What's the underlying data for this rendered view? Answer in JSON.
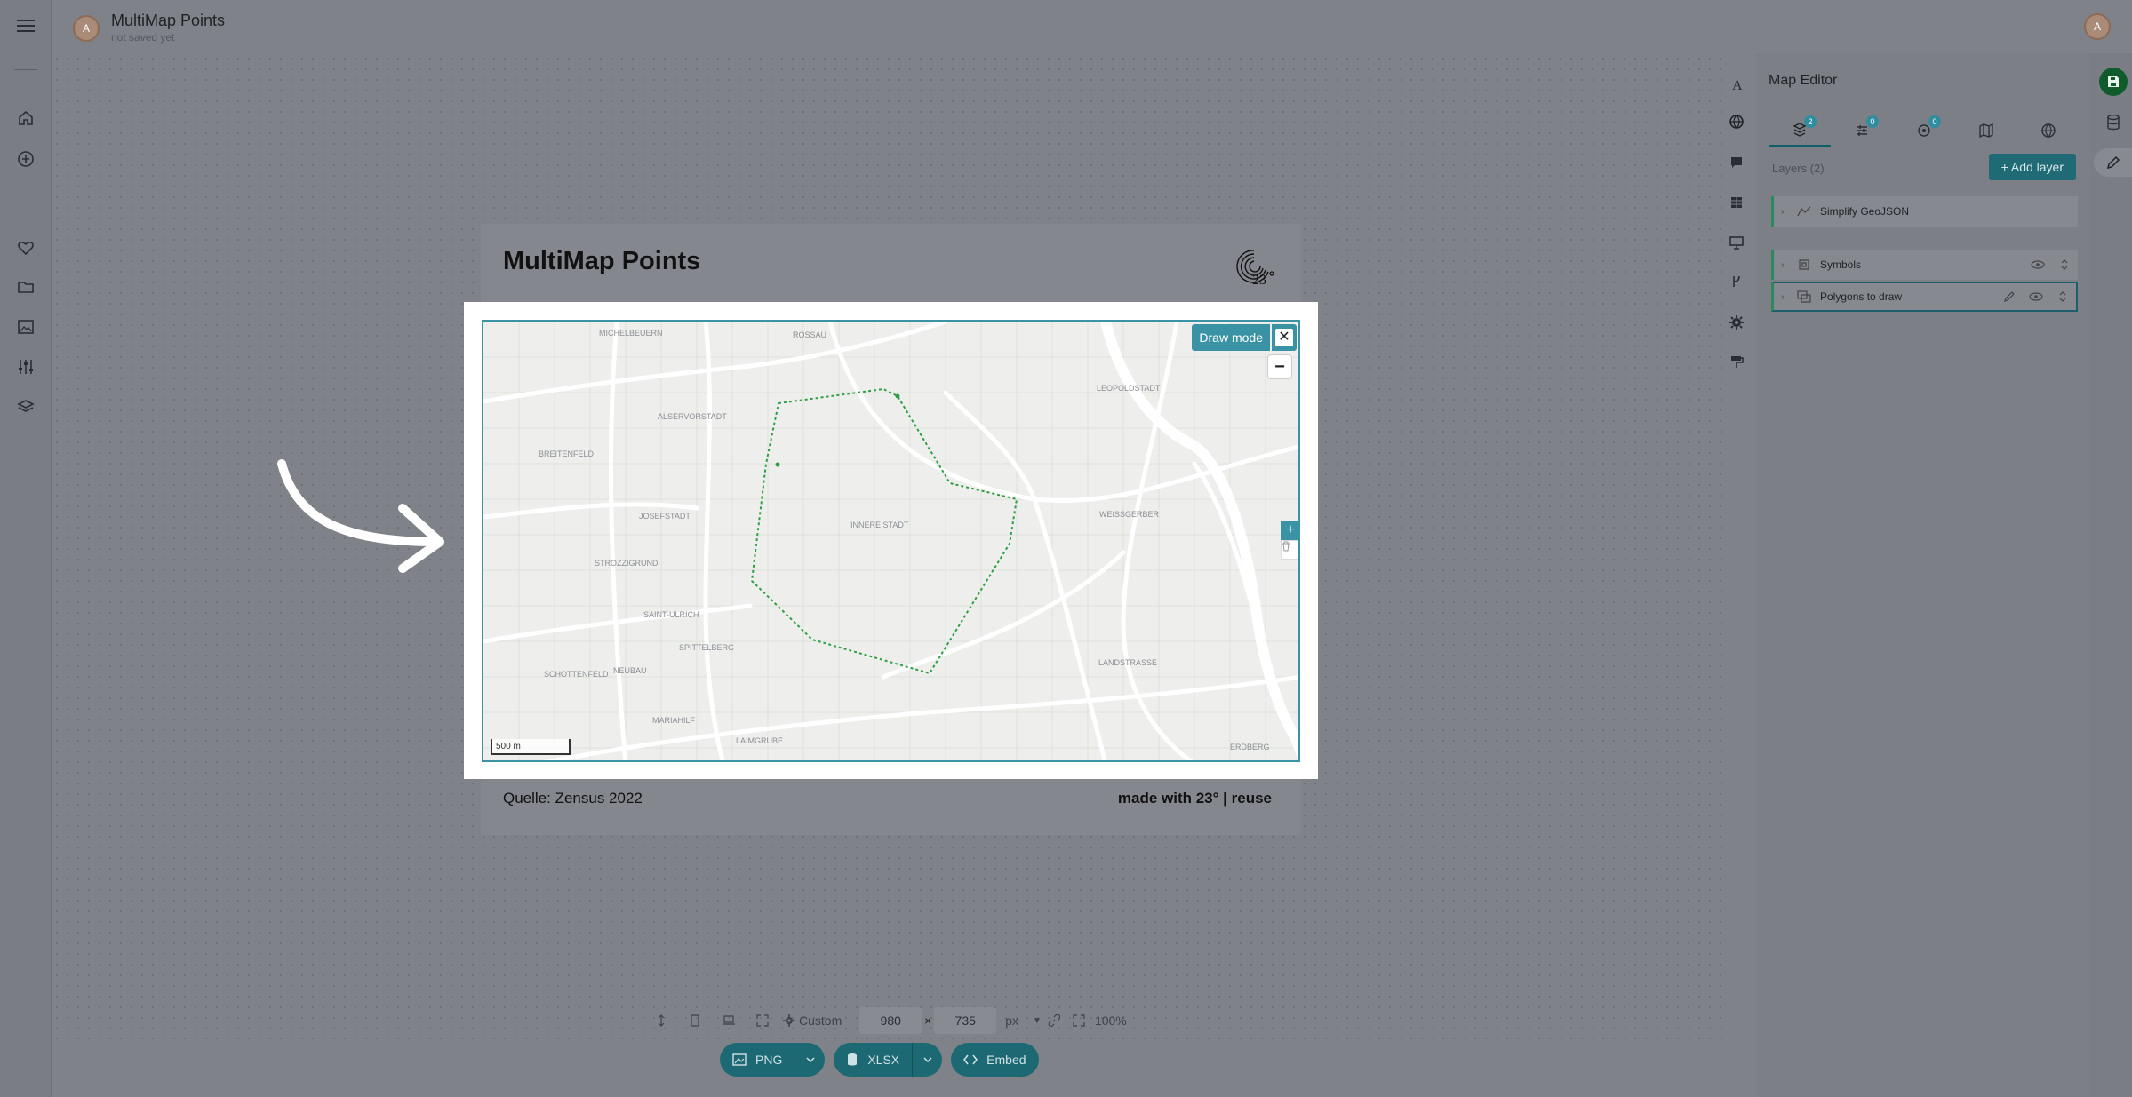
{
  "header": {
    "avatar_initial": "A",
    "title": "MultiMap Points",
    "subtitle": "not saved yet",
    "user_initial": "A"
  },
  "card": {
    "title": "MultiMap Points",
    "source": "Quelle: Zensus 2022",
    "made_with": "made with 23° | reuse"
  },
  "map": {
    "draw_mode_label": "Draw mode",
    "close_glyph": "✕",
    "zoom_out_glyph": "−",
    "add_glyph": "+",
    "scale_label": "500 m",
    "labels": [
      "MICHELBEUERN",
      "ROSSAU",
      "LEOPOLDSTADT",
      "ALSERVORSTADT",
      "BREITENFELD",
      "JOSEFSTADT",
      "INNERE STADT",
      "WEISSGERBER",
      "STROZZIGRUND",
      "SAINT-ULRICH",
      "SPITTELBERG",
      "SCHOTTENFELD",
      "NEUBAU",
      "LANDSTRASSE",
      "MARIAHILF",
      "LAIMGRUBE",
      "ERDBERG"
    ],
    "accent_color": "#3a93a4",
    "polygon_color": "#2f9e44"
  },
  "editor": {
    "title": "Map Editor",
    "tabs": [
      {
        "name": "layers",
        "badge": "2"
      },
      {
        "name": "filters",
        "badge": "0"
      },
      {
        "name": "effects",
        "badge": "0"
      },
      {
        "name": "basemap",
        "badge": ""
      },
      {
        "name": "projection",
        "badge": ""
      }
    ],
    "layers_label": "Layers (2)",
    "add_layer_label": "+ Add layer",
    "layers": [
      {
        "name": "Simplify GeoJSON"
      },
      {
        "name": "Symbols"
      },
      {
        "name": "Polygons to draw"
      }
    ]
  },
  "sizebar": {
    "preset": "Custom",
    "width": "980",
    "times": "×",
    "height": "735",
    "unit": "px",
    "zoom": "100%"
  },
  "export": {
    "png": "PNG",
    "xlsx": "XLSX",
    "embed": "Embed"
  }
}
